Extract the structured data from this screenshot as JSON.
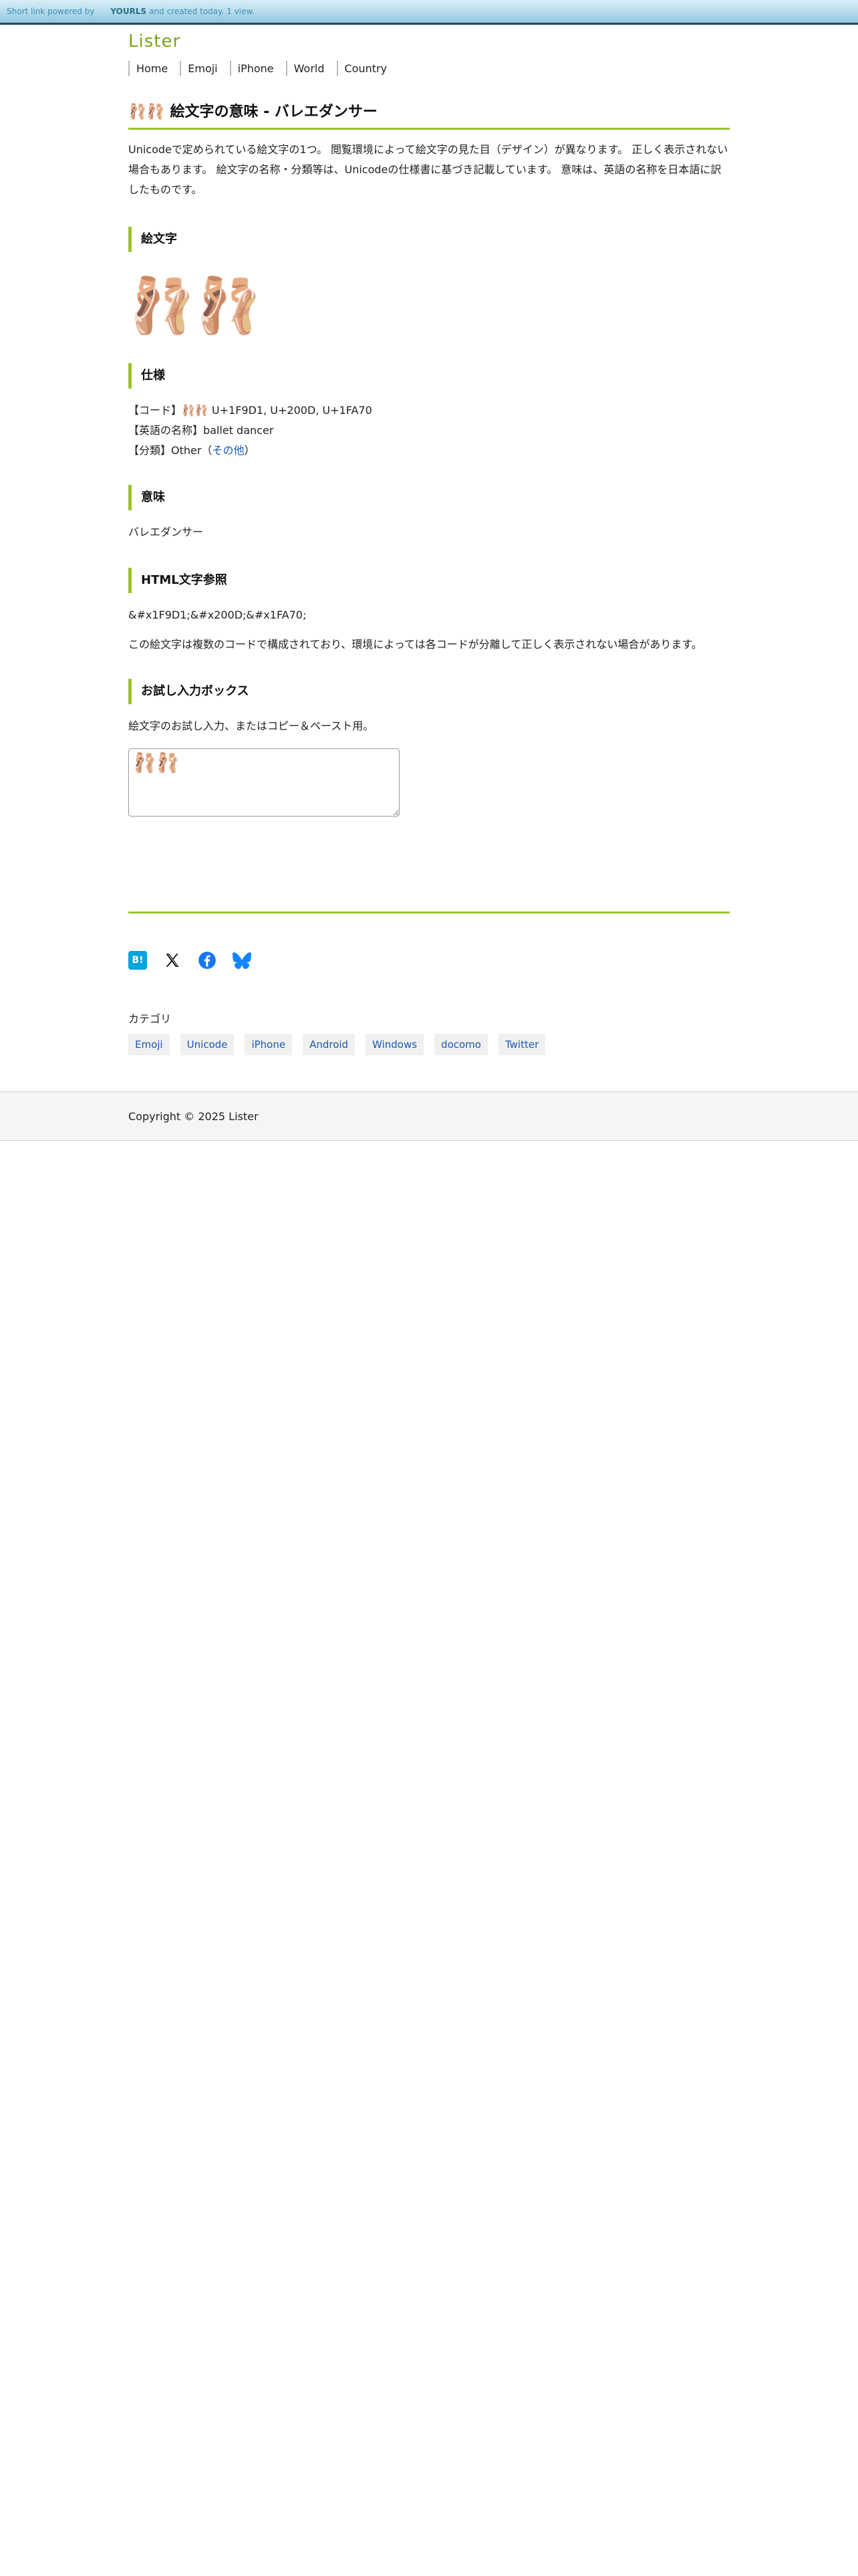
{
  "yourls_bar": {
    "prefix": "Short link powered by",
    "brand": "YOURLS",
    "suffix": "and created today. 1 view."
  },
  "site": {
    "logo": "Lister"
  },
  "nav": [
    {
      "label": "Home"
    },
    {
      "label": "Emoji"
    },
    {
      "label": "iPhone"
    },
    {
      "label": "World"
    },
    {
      "label": "Country"
    }
  ],
  "page": {
    "title": "🩰🩰 絵文字の意味 - バレエダンサー",
    "intro": "Unicodeで定められている絵文字の1つ。 閲覧環境によって絵文字の見た目（デザイン）が異なります。 正しく表示されない場合もあります。 絵文字の名称・分類等は、Unicodeの仕様書に基づき記載しています。 意味は、英語の名称を日本語に訳したものです。"
  },
  "sections": {
    "emoji": {
      "heading": "絵文字",
      "glyph": "🩰🩰"
    },
    "spec": {
      "heading": "仕様",
      "code_line": "【コード】🩰🩰 U+1F9D1, U+200D, U+1FA70",
      "name_line": "【英語の名称】ballet dancer",
      "category_prefix": "【分類】Other（",
      "category_link": "その他",
      "category_suffix": "）"
    },
    "meaning": {
      "heading": "意味",
      "text": "バレエダンサー"
    },
    "html_ref": {
      "heading": "HTML文字参照",
      "code": "&#x1F9D1;&#x200D;&#x1FA70;",
      "note": "この絵文字は複数のコードで構成されており、環境によっては各コードが分離して正しく表示されない場合があります。"
    },
    "trybox": {
      "heading": "お試し入力ボックス",
      "description": "絵文字のお試し入力、またはコピー＆ペースト用。",
      "value": "🩰🩰"
    }
  },
  "share": {
    "hatena_label": "B!",
    "icons": [
      "hatena-bookmark-icon",
      "x-icon",
      "facebook-icon",
      "bluesky-icon"
    ]
  },
  "categories": {
    "label": "カテゴリ",
    "tags": [
      "Emoji",
      "Unicode",
      "iPhone",
      "Android",
      "Windows",
      "docomo",
      "Twitter"
    ]
  },
  "footer": {
    "copyright": "Copyright © 2025 Lister"
  },
  "colors": {
    "accent": "#9cc32a",
    "logo": "#7aa414",
    "link": "#1a58b4",
    "hatena": "#00a4de",
    "facebook": "#1877f2",
    "bluesky": "#1185fe"
  }
}
